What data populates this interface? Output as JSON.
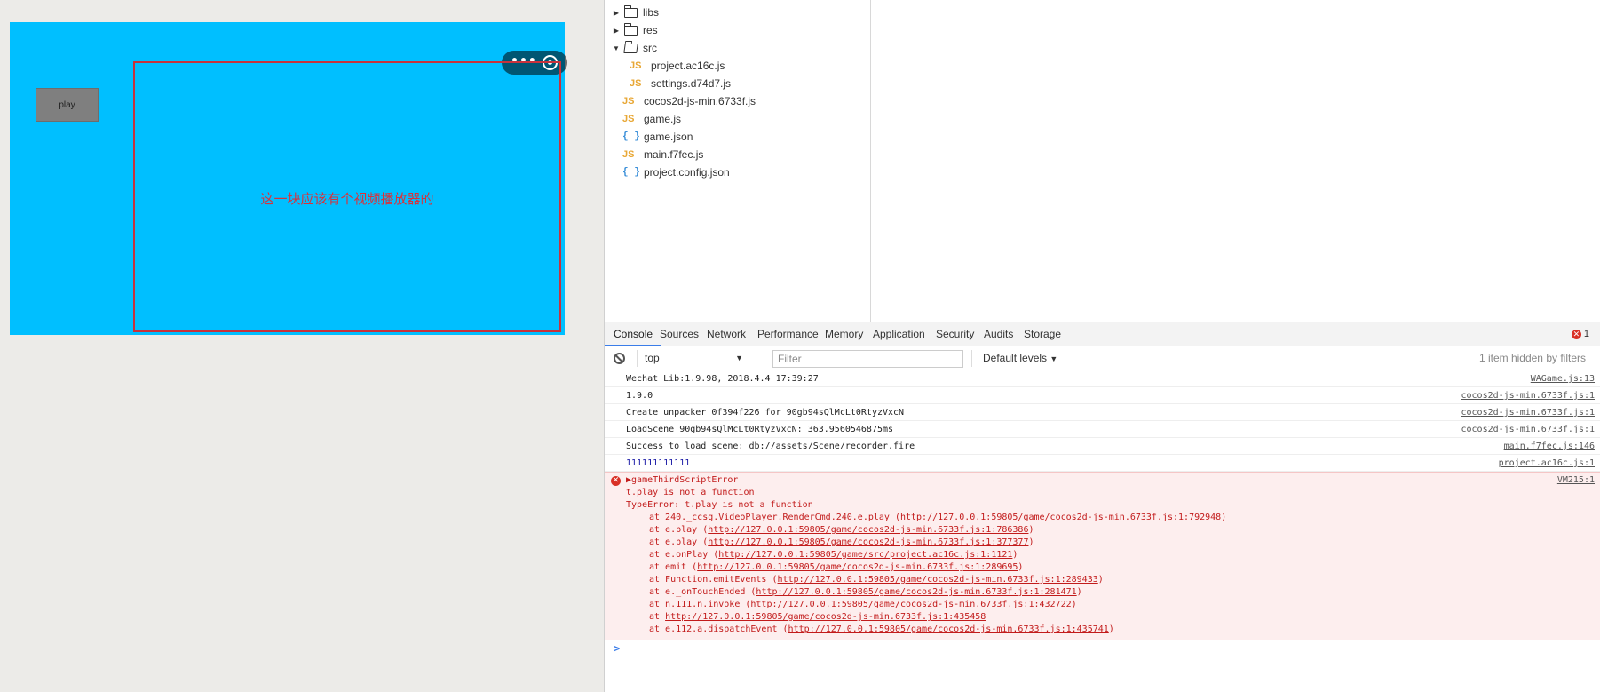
{
  "simulator": {
    "play_button_label": "play",
    "video_note": "这一块应该有个视频播放器的",
    "capsule_menu_icon": "more-dots-icon",
    "capsule_close_icon": "target-close-icon",
    "background_color": "#00bfff",
    "frame_color": "#c8323c"
  },
  "file_tree": [
    {
      "type": "folder",
      "label": "libs",
      "expanded": false,
      "depth": 0
    },
    {
      "type": "folder",
      "label": "res",
      "expanded": false,
      "depth": 0
    },
    {
      "type": "folder",
      "label": "src",
      "expanded": true,
      "depth": 0
    },
    {
      "type": "js",
      "label": "project.ac16c.js",
      "depth": 1
    },
    {
      "type": "js",
      "label": "settings.d74d7.js",
      "depth": 1
    },
    {
      "type": "js",
      "label": "cocos2d-js-min.6733f.js",
      "depth": 0
    },
    {
      "type": "js",
      "label": "game.js",
      "depth": 0
    },
    {
      "type": "json",
      "label": "game.json",
      "depth": 0
    },
    {
      "type": "js",
      "label": "main.f7fec.js",
      "depth": 0
    },
    {
      "type": "json",
      "label": "project.config.json",
      "depth": 0
    }
  ],
  "icons": {
    "js": "JS",
    "json": "{ }"
  },
  "tabs": [
    "Console",
    "Sources",
    "Network",
    "Performance",
    "Memory",
    "Application",
    "Security",
    "Audits",
    "Storage"
  ],
  "error_count": "1",
  "toolbar": {
    "context": "top",
    "filter_placeholder": "Filter",
    "levels": "Default levels",
    "hidden_note": "1 item hidden by filters"
  },
  "logs": [
    {
      "msg": "Wechat Lib:1.9.98, 2018.4.4 17:39:27",
      "src": "WAGame.js:13"
    },
    {
      "msg": "1.9.0",
      "src": "cocos2d-js-min.6733f.js:1"
    },
    {
      "msg": "Create unpacker 0f394f226 for 90gb94sQlMcLt0RtyzVxcN",
      "src": "cocos2d-js-min.6733f.js:1"
    },
    {
      "msg": "LoadScene 90gb94sQlMcLt0RtyzVxcN: 363.9560546875ms",
      "src": "cocos2d-js-min.6733f.js:1"
    },
    {
      "msg": "Success to load scene: db://assets/Scene/recorder.fire",
      "src": "main.f7fec.js:146"
    },
    {
      "msg": "111111111111",
      "src": "project.ac16c.js:1"
    }
  ],
  "error": {
    "title": "gameThirdScriptError",
    "src": "VM215:1",
    "line1": "t.play is not a function",
    "line2": "TypeError: t.play is not a function",
    "stack": [
      {
        "pre": "at 240._ccsg.VideoPlayer.RenderCmd.240.e.play (",
        "url": "http://127.0.0.1:59805/game/cocos2d-js-min.6733f.js:1:792948",
        "post": ")"
      },
      {
        "pre": "at e.play (",
        "url": "http://127.0.0.1:59805/game/cocos2d-js-min.6733f.js:1:786386",
        "post": ")"
      },
      {
        "pre": "at e.play (",
        "url": "http://127.0.0.1:59805/game/cocos2d-js-min.6733f.js:1:377377",
        "post": ")"
      },
      {
        "pre": "at e.onPlay (",
        "url": "http://127.0.0.1:59805/game/src/project.ac16c.js:1:1121",
        "post": ")"
      },
      {
        "pre": "at emit (",
        "url": "http://127.0.0.1:59805/game/cocos2d-js-min.6733f.js:1:289695",
        "post": ")"
      },
      {
        "pre": "at Function.emitEvents (",
        "url": "http://127.0.0.1:59805/game/cocos2d-js-min.6733f.js:1:289433",
        "post": ")"
      },
      {
        "pre": "at e._onTouchEnded (",
        "url": "http://127.0.0.1:59805/game/cocos2d-js-min.6733f.js:1:281471",
        "post": ")"
      },
      {
        "pre": "at n.111.n.invoke (",
        "url": "http://127.0.0.1:59805/game/cocos2d-js-min.6733f.js:1:432722",
        "post": ")"
      },
      {
        "pre": "at ",
        "url": "http://127.0.0.1:59805/game/cocos2d-js-min.6733f.js:1:435458",
        "post": ""
      },
      {
        "pre": "at e.112.a.dispatchEvent (",
        "url": "http://127.0.0.1:59805/game/cocos2d-js-min.6733f.js:1:435741",
        "post": ")"
      }
    ]
  },
  "prompt_symbol": ">"
}
